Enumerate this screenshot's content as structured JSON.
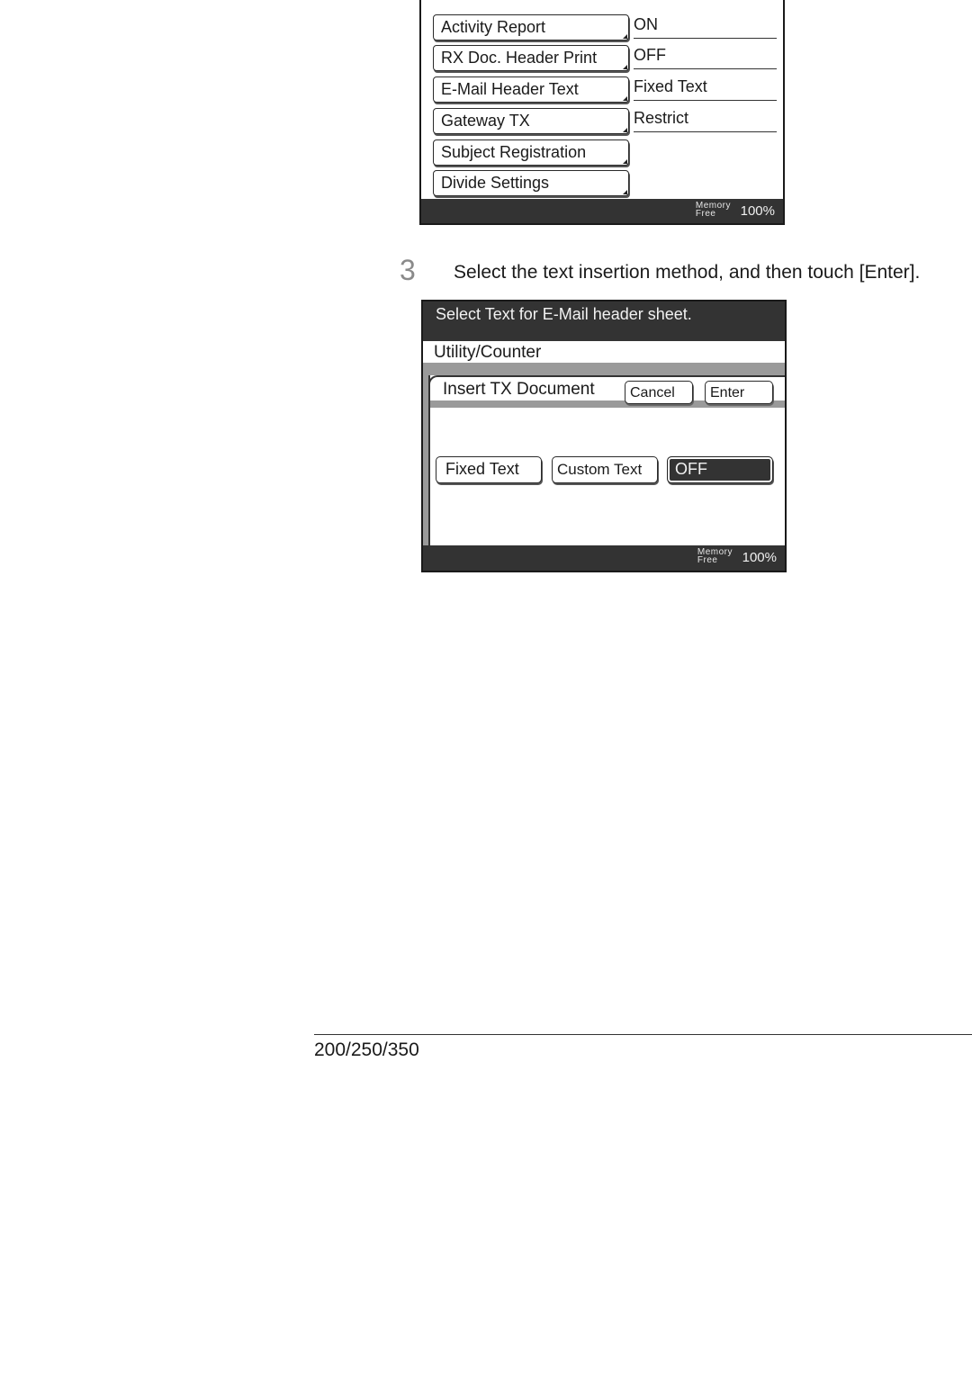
{
  "panel1": {
    "rows": [
      {
        "label": "Activity Report",
        "value": "ON"
      },
      {
        "label": "RX Doc. Header Print",
        "value": "OFF"
      },
      {
        "label": "E-Mail Header Text",
        "value": "Fixed Text"
      },
      {
        "label": "Gateway TX",
        "value": "Restrict"
      },
      {
        "label": "Subject Registration",
        "value": ""
      },
      {
        "label": "Divide Settings",
        "value": ""
      }
    ],
    "status": {
      "memory_label_top": "Memory",
      "memory_label_bottom": "Free",
      "memory_value": "100%"
    }
  },
  "step": {
    "number": "3",
    "text": "Select the text insertion method, and then touch [Enter]."
  },
  "panel2": {
    "message": "Select Text for E-Mail header sheet.",
    "breadcrumb": "Utility/Counter",
    "section_title": "Insert TX Document",
    "cancel_label": "Cancel",
    "enter_label": "Enter",
    "options": [
      {
        "label": "Fixed Text",
        "selected": false
      },
      {
        "label": "Custom Text",
        "selected": false
      },
      {
        "label": "OFF",
        "selected": true
      }
    ],
    "status": {
      "memory_label_top": "Memory",
      "memory_label_bottom": "Free",
      "memory_value": "100%"
    }
  },
  "footer": {
    "model": "200/250/350"
  }
}
